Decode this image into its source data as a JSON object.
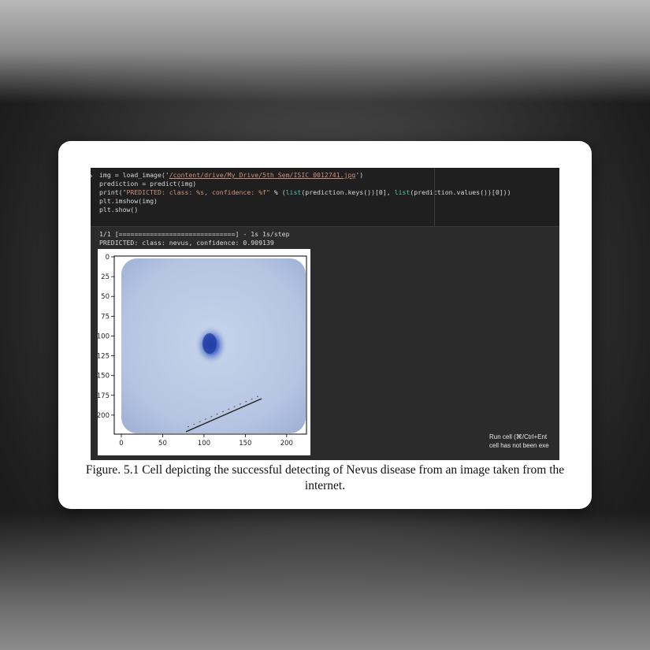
{
  "notebook": {
    "code_lines": [
      {
        "parts": [
          {
            "t": "img = load_image('",
            "c": ""
          },
          {
            "t": "/content/drive/My Drive/5th Sem/ISIC_0012741.jpg",
            "c": "strl"
          },
          {
            "t": "')",
            "c": ""
          }
        ]
      },
      {
        "parts": [
          {
            "t": "prediction = predict(img)",
            "c": ""
          }
        ]
      },
      {
        "parts": [
          {
            "t": "print(",
            "c": ""
          },
          {
            "t": "\"PREDICTED: class: %s, confidence: %f\"",
            "c": "str"
          },
          {
            "t": " % (",
            "c": ""
          },
          {
            "t": "list",
            "c": "fn"
          },
          {
            "t": "(prediction.keys())[0], ",
            "c": ""
          },
          {
            "t": "list",
            "c": "fn"
          },
          {
            "t": "(prediction.values())[0]))",
            "c": ""
          }
        ]
      },
      {
        "parts": [
          {
            "t": "plt.imshow(img)",
            "c": ""
          }
        ]
      },
      {
        "parts": [
          {
            "t": "plt.show()",
            "c": ""
          }
        ]
      }
    ],
    "output_progress": "1/1 [==============================] - 1s 1s/step",
    "output_prediction": "PREDICTED: class: nevus, confidence: 0.909139",
    "tooltip_line1": "Run cell (⌘/Ctrl+Ent",
    "tooltip_line2": "cell has not been exe"
  },
  "plot": {
    "y_ticks": [
      "0",
      "25",
      "50",
      "75",
      "100",
      "125",
      "150",
      "175",
      "200"
    ],
    "x_ticks": [
      "0",
      "50",
      "100",
      "150",
      "200"
    ]
  },
  "caption": {
    "line1": "Figure. 5.1 Cell depicting the successful detecting of Nevus disease from an image taken from the",
    "line2": "internet."
  }
}
